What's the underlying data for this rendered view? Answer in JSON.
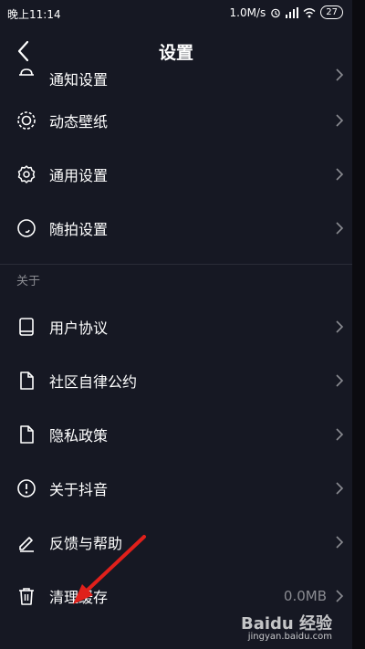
{
  "status_bar": {
    "time": "晚上11:14",
    "net_speed": "1.0M/s",
    "battery": "27"
  },
  "header": {
    "title": "设置"
  },
  "list": {
    "partial_item": {
      "label": "通知设置",
      "icon": "bell-icon"
    },
    "items": [
      {
        "label": "动态壁纸",
        "icon": "live-wallpaper-icon"
      },
      {
        "label": "通用设置",
        "icon": "gear-icon"
      },
      {
        "label": "随拍设置",
        "icon": "circle-shot-icon"
      }
    ],
    "section_about": {
      "label": "关于"
    },
    "about_items": [
      {
        "label": "用户协议",
        "icon": "book-icon"
      },
      {
        "label": "社区自律公约",
        "icon": "document-icon"
      },
      {
        "label": "隐私政策",
        "icon": "document-icon"
      },
      {
        "label": "关于抖音",
        "icon": "info-icon"
      },
      {
        "label": "反馈与帮助",
        "icon": "edit-icon"
      },
      {
        "label": "清理缓存",
        "icon": "trash-icon",
        "value": "0.0MB"
      }
    ]
  },
  "watermark": {
    "logo": "Baidu 经验",
    "url": "jingyan.baidu.com"
  },
  "colors": {
    "background": "#161823",
    "text": "#ffffff",
    "muted": "#8a8b91",
    "arrow": "#e0201b"
  }
}
